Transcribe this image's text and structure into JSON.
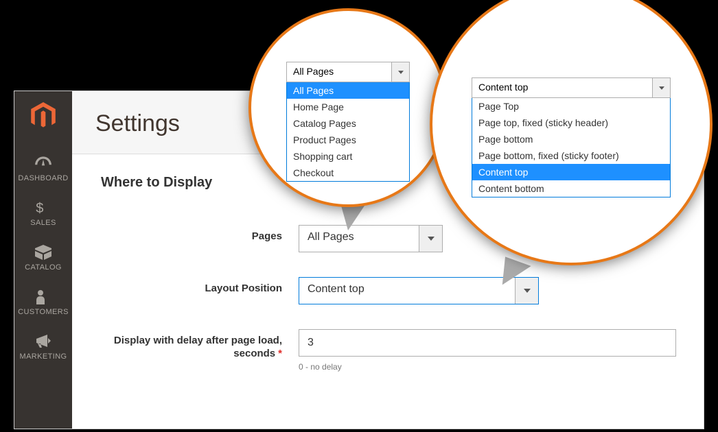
{
  "sidebar": {
    "items": [
      {
        "label": "DASHBOARD"
      },
      {
        "label": "SALES"
      },
      {
        "label": "CATALOG"
      },
      {
        "label": "CUSTOMERS"
      },
      {
        "label": "MARKETING"
      }
    ]
  },
  "header": {
    "title": "Settings"
  },
  "section": {
    "title": "Where to Display"
  },
  "fields": {
    "pages": {
      "label": "Pages",
      "value": "All Pages"
    },
    "layout": {
      "label": "Layout Position",
      "value": "Content top"
    },
    "delay": {
      "label": "Display with delay after page load, seconds",
      "value": "3",
      "hint": "0 - no delay"
    }
  },
  "bubble1": {
    "selected": "All Pages",
    "options": [
      "All Pages",
      "Home Page",
      "Catalog Pages",
      "Product Pages",
      "Shopping cart",
      "Checkout"
    ],
    "highlight_index": 0
  },
  "bubble2": {
    "selected": "Content top",
    "options": [
      "Page Top",
      "Page top, fixed (sticky header)",
      "Page bottom",
      "Page bottom, fixed (sticky footer)",
      "Content top",
      "Content bottom"
    ],
    "highlight_index": 4
  }
}
